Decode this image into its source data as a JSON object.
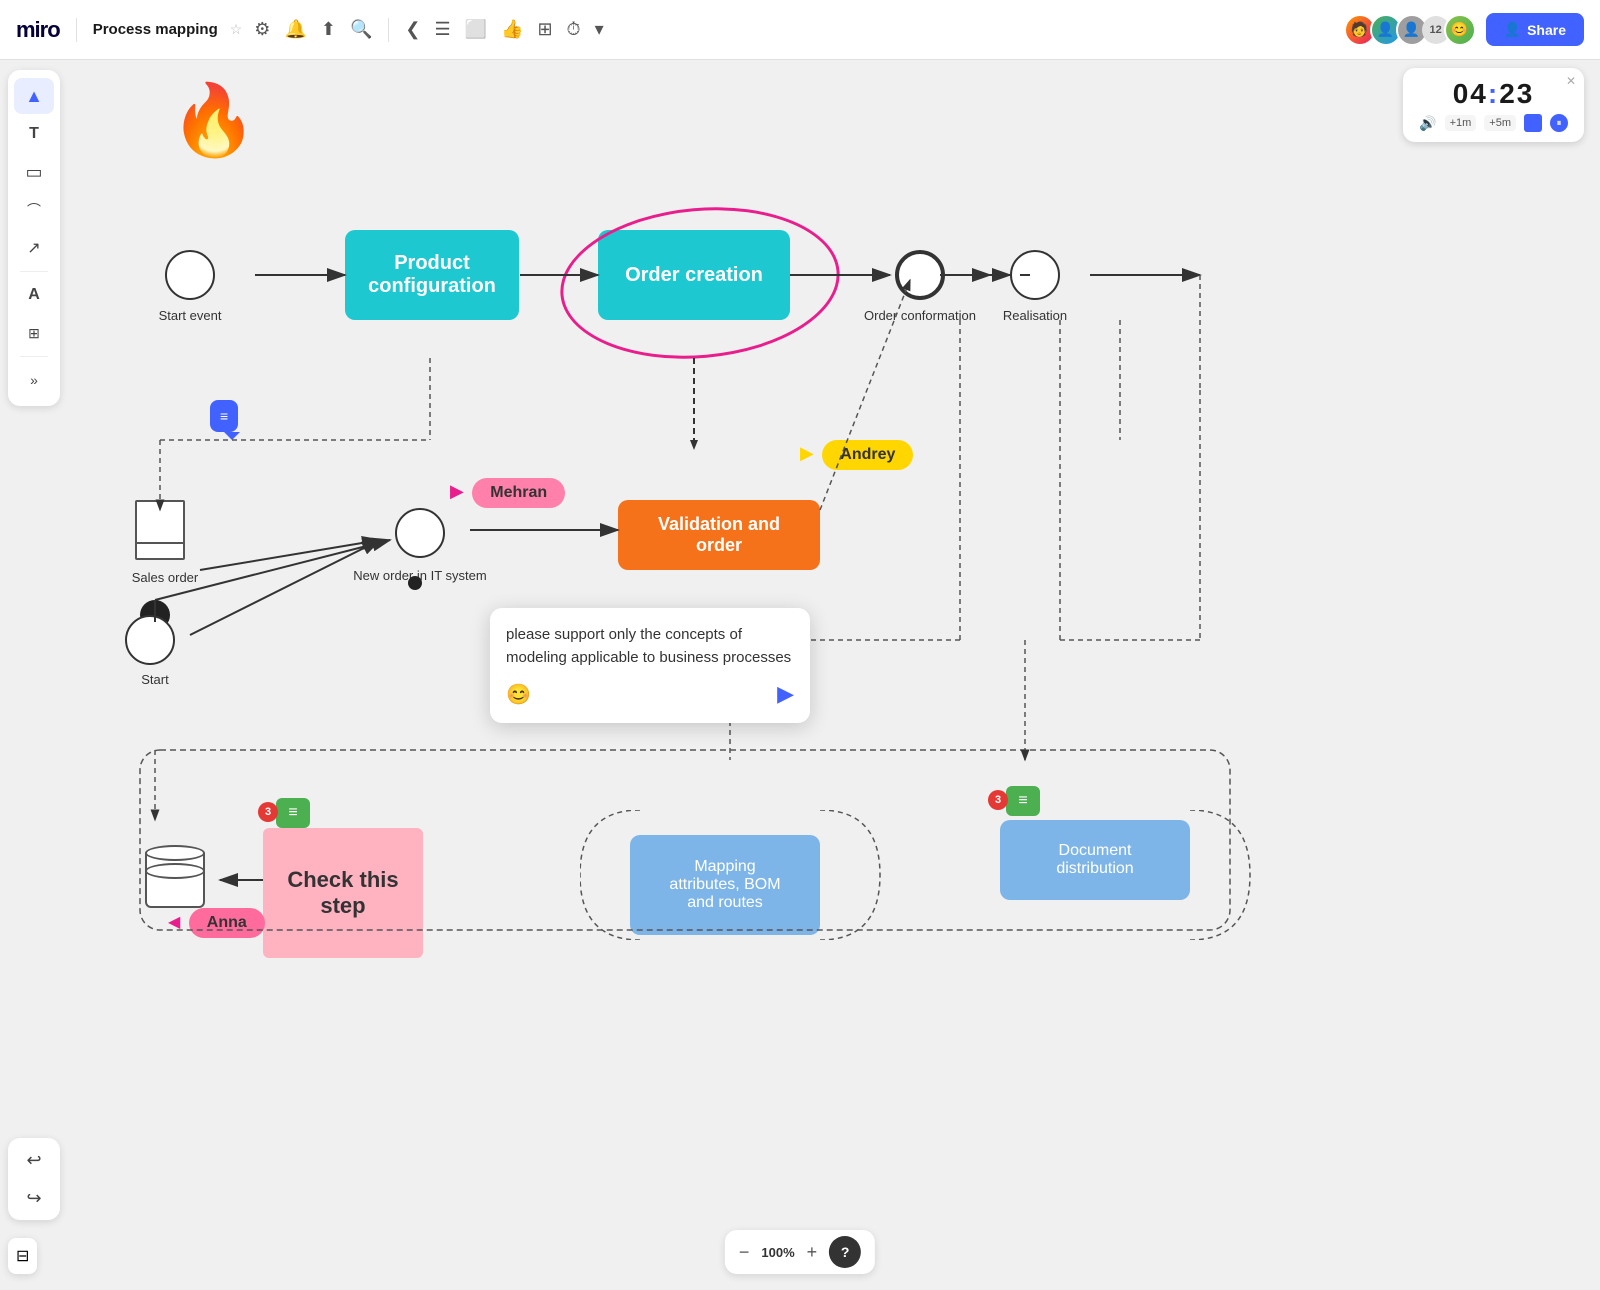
{
  "app": {
    "name": "miro",
    "board_title": "Process mapping",
    "share_label": "Share"
  },
  "timer": {
    "minutes": "04",
    "seconds": "23",
    "add1m": "+1m",
    "add5m": "+5m"
  },
  "toolbar": {
    "tools": [
      {
        "name": "select",
        "icon": "▲"
      },
      {
        "name": "text",
        "icon": "T"
      },
      {
        "name": "sticky",
        "icon": "▭"
      },
      {
        "name": "shapes",
        "icon": "⌒"
      },
      {
        "name": "line",
        "icon": "↗"
      },
      {
        "name": "font",
        "icon": "A"
      },
      {
        "name": "frame",
        "icon": "⊞"
      },
      {
        "name": "more",
        "icon": "»"
      }
    ]
  },
  "nodes": {
    "start_event": "Start event",
    "product_configuration": "Product\nconfiguration",
    "order_creation": "Order creation",
    "order_conformation_label": "Order\nconformation",
    "realisation_label": "Realisation",
    "sales_order": "Sales order",
    "new_order_it": "New order in IT\nsystem",
    "validation_order": "Validation and\norder",
    "start2": "Start",
    "check_this_step": "Check this\nstep",
    "mapping_attributes": "Mapping\nattributes, BOM\nand routes",
    "document_distribution": "Document\ndistribution"
  },
  "cursors": {
    "mehran": "Mehran",
    "andrey": "Andrey",
    "anna": "Anna"
  },
  "comment": {
    "text": "please support only the concepts of modeling applicable to business processes",
    "emoji_icon": "😊"
  },
  "zoom": {
    "level": "100%",
    "minus": "−",
    "plus": "+"
  },
  "help": "?"
}
